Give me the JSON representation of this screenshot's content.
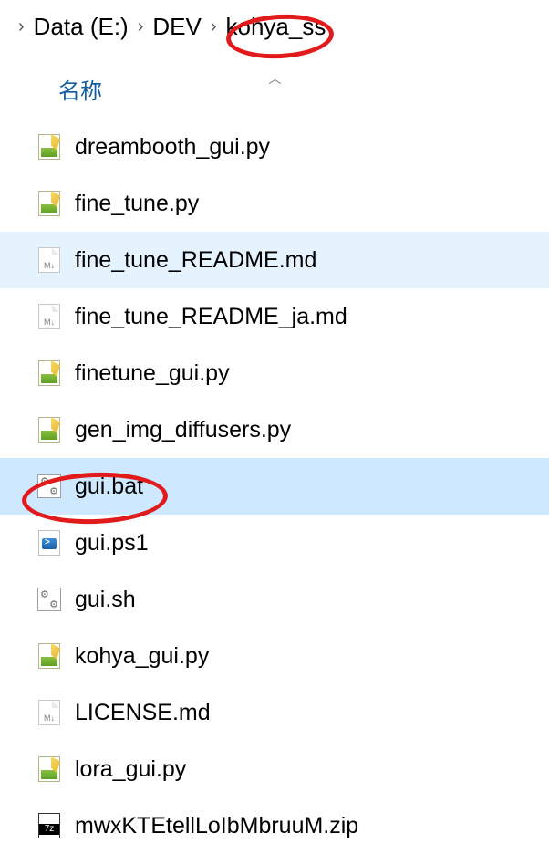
{
  "breadcrumb": {
    "seg1": "Data (E:)",
    "seg2": "DEV",
    "seg3": "kohya_ss"
  },
  "columns": {
    "name": "名称"
  },
  "files": [
    {
      "name": "dreambooth_gui.py",
      "icon": "py",
      "state": ""
    },
    {
      "name": "fine_tune.py",
      "icon": "py",
      "state": ""
    },
    {
      "name": "fine_tune_README.md",
      "icon": "md",
      "state": "hover"
    },
    {
      "name": "fine_tune_README_ja.md",
      "icon": "md",
      "state": ""
    },
    {
      "name": "finetune_gui.py",
      "icon": "py",
      "state": ""
    },
    {
      "name": "gen_img_diffusers.py",
      "icon": "py",
      "state": ""
    },
    {
      "name": "gui.bat",
      "icon": "bat",
      "state": "selected"
    },
    {
      "name": "gui.ps1",
      "icon": "ps1",
      "state": ""
    },
    {
      "name": "gui.sh",
      "icon": "sh",
      "state": ""
    },
    {
      "name": "kohya_gui.py",
      "icon": "py",
      "state": ""
    },
    {
      "name": "LICENSE.md",
      "icon": "md",
      "state": ""
    },
    {
      "name": "lora_gui.py",
      "icon": "py",
      "state": ""
    },
    {
      "name": "mwxKTEtellLoIbMbruuM.zip",
      "icon": "7z",
      "state": ""
    }
  ],
  "annotations": {
    "circle_breadcrumb": "kohya_ss",
    "circle_file": "gui.bat"
  }
}
